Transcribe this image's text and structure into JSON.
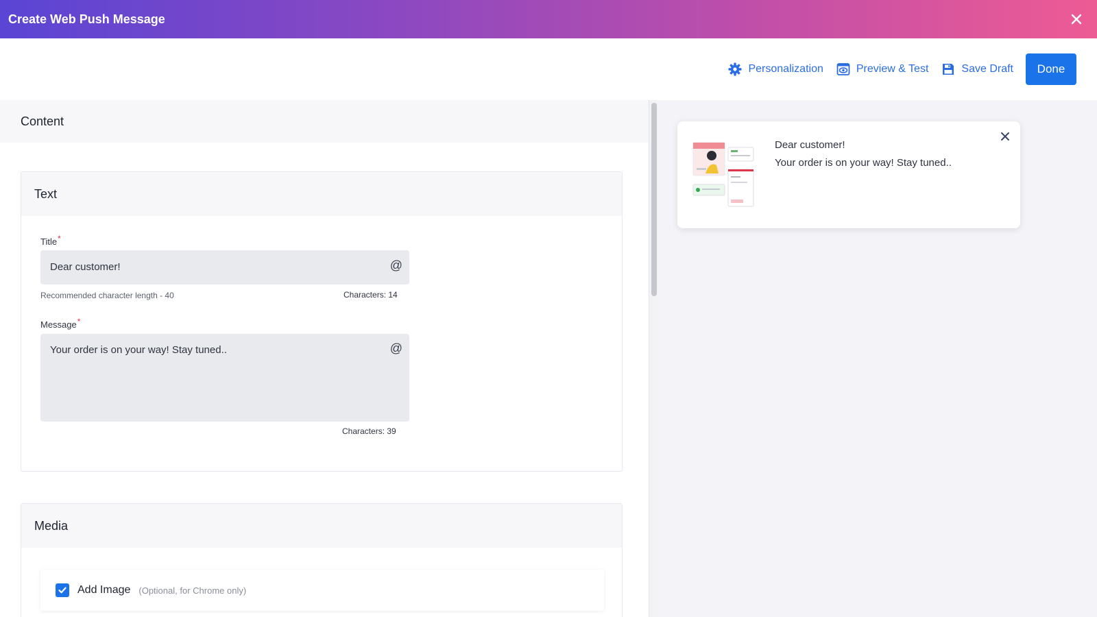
{
  "header": {
    "title": "Create Web Push Message"
  },
  "actions": {
    "personalization": "Personalization",
    "preview_test": "Preview & Test",
    "save_draft": "Save Draft",
    "done": "Done"
  },
  "content": {
    "section_title": "Content",
    "text_card": {
      "title": "Text",
      "title_field": {
        "label": "Title",
        "required_mark": "*",
        "value": "Dear customer!",
        "at_symbol": "@",
        "hint": "Recommended character length - 40",
        "char_count": "Characters: 14"
      },
      "message_field": {
        "label": "Message",
        "required_mark": "*",
        "value": "Your order is on your way! Stay tuned..",
        "at_symbol": "@",
        "char_count": "Characters: 39"
      }
    },
    "media_card": {
      "title": "Media",
      "add_image": {
        "label": "Add Image",
        "note": "(Optional, for Chrome only)",
        "checked": true
      }
    }
  },
  "preview": {
    "title": "Dear customer!",
    "message": "Your order is on your way! Stay tuned.."
  },
  "icons": {
    "close": "close-icon",
    "personalization": "gear-icon",
    "preview": "eye-icon",
    "save": "floppy-disk-icon",
    "checkbox": "checkmark-icon"
  },
  "colors": {
    "accent": "#1a73e8",
    "link": "#2a6de3",
    "header_gradient_start": "#5a45d4",
    "header_gradient_end": "#ee5b94",
    "required": "#e0344b"
  }
}
